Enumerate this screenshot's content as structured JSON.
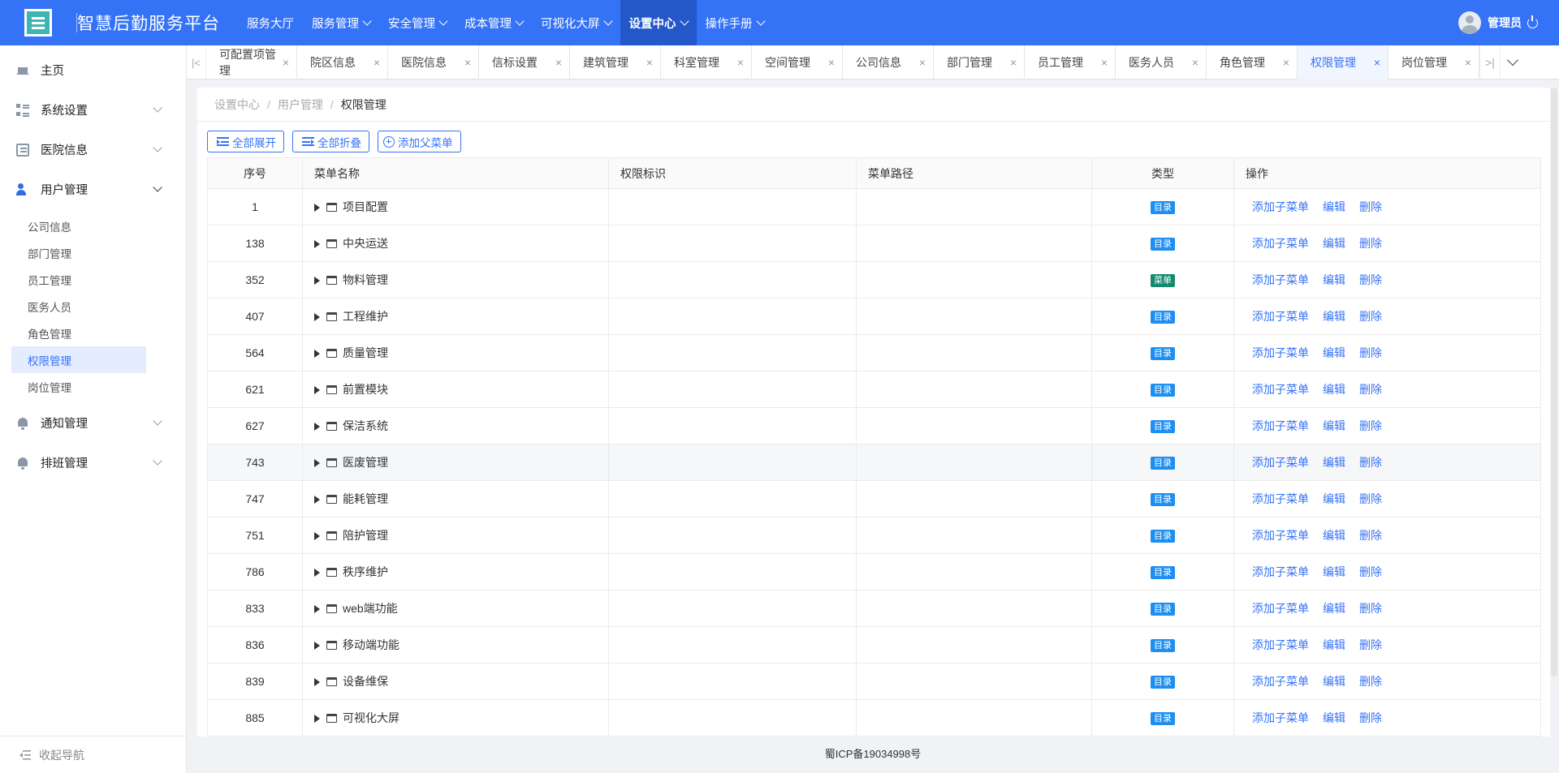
{
  "app": {
    "title": "智慧后勤服务平台"
  },
  "nav": [
    {
      "label": "服务大厅",
      "caret": false
    },
    {
      "label": "服务管理",
      "caret": true
    },
    {
      "label": "安全管理",
      "caret": true
    },
    {
      "label": "成本管理",
      "caret": true
    },
    {
      "label": "可视化大屏",
      "caret": true
    },
    {
      "label": "设置中心",
      "caret": true,
      "active": true
    },
    {
      "label": "操作手册",
      "caret": true
    }
  ],
  "user": {
    "name": "管理员"
  },
  "sidebar": {
    "home": "主页",
    "groups": [
      {
        "label": "系统设置",
        "icon": "grid-icon"
      },
      {
        "label": "医院信息",
        "icon": "document-icon"
      },
      {
        "label": "用户管理",
        "icon": "user-icon",
        "open": true
      }
    ],
    "user_mgmt_items": [
      "公司信息",
      "部门管理",
      "员工管理",
      "医务人员",
      "角色管理",
      "权限管理",
      "岗位管理"
    ],
    "active_item": "权限管理",
    "groups_after": [
      {
        "label": "通知管理",
        "icon": "bell-icon"
      },
      {
        "label": "排班管理",
        "icon": "bell-icon"
      }
    ],
    "collapse_label": "收起导航"
  },
  "tabs": [
    "可配置项管理",
    "院区信息",
    "医院信息",
    "信标设置",
    "建筑管理",
    "科室管理",
    "空间管理",
    "公司信息",
    "部门管理",
    "员工管理",
    "医务人员",
    "角色管理",
    "权限管理",
    "岗位管理"
  ],
  "active_tab": "权限管理",
  "breadcrumb": [
    "设置中心",
    "用户管理",
    "权限管理"
  ],
  "toolbar": {
    "expand_all": "全部展开",
    "collapse_all": "全部折叠",
    "add_parent": "添加父菜单"
  },
  "table": {
    "columns": [
      "序号",
      "菜单名称",
      "权限标识",
      "菜单路径",
      "类型",
      "操作"
    ],
    "actions": [
      "添加子菜单",
      "编辑",
      "删除"
    ],
    "rows": [
      {
        "id": "1",
        "name": "项目配置",
        "perm": "",
        "path": "",
        "type": "目录"
      },
      {
        "id": "138",
        "name": "中央运送",
        "perm": "",
        "path": "",
        "type": "目录"
      },
      {
        "id": "352",
        "name": "物料管理",
        "perm": "",
        "path": "",
        "type": "菜单"
      },
      {
        "id": "407",
        "name": "工程维护",
        "perm": "",
        "path": "",
        "type": "目录"
      },
      {
        "id": "564",
        "name": "质量管理",
        "perm": "",
        "path": "",
        "type": "目录"
      },
      {
        "id": "621",
        "name": "前置模块",
        "perm": "",
        "path": "",
        "type": "目录"
      },
      {
        "id": "627",
        "name": "保洁系统",
        "perm": "",
        "path": "",
        "type": "目录"
      },
      {
        "id": "743",
        "name": "医废管理",
        "perm": "",
        "path": "",
        "type": "目录"
      },
      {
        "id": "747",
        "name": "能耗管理",
        "perm": "",
        "path": "",
        "type": "目录"
      },
      {
        "id": "751",
        "name": "陪护管理",
        "perm": "",
        "path": "",
        "type": "目录"
      },
      {
        "id": "786",
        "name": "秩序维护",
        "perm": "",
        "path": "",
        "type": "目录"
      },
      {
        "id": "833",
        "name": "web端功能",
        "perm": "",
        "path": "",
        "type": "目录"
      },
      {
        "id": "836",
        "name": "移动端功能",
        "perm": "",
        "path": "",
        "type": "目录"
      },
      {
        "id": "839",
        "name": "设备维保",
        "perm": "",
        "path": "",
        "type": "目录"
      },
      {
        "id": "885",
        "name": "可视化大屏",
        "perm": "",
        "path": "",
        "type": "目录"
      }
    ]
  },
  "footer": {
    "icp": "蜀ICP备19034998号"
  },
  "colors": {
    "primary": "#3573f6",
    "nav_active": "#2457c8",
    "badge_dir": "#1e8ef0",
    "badge_menu": "#138a6f"
  }
}
